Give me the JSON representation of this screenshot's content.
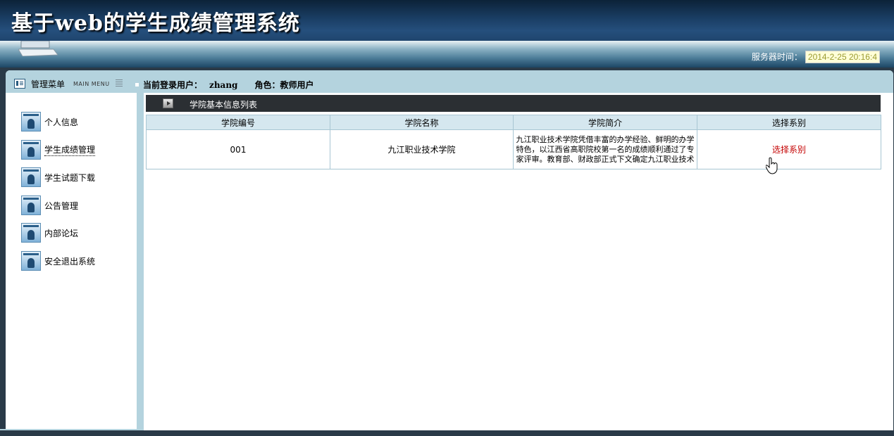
{
  "header": {
    "title": "基于web的学生成绩管理系统",
    "server_time_label": "服务器时间：",
    "server_time_value": "2014-2-25 20:16:4"
  },
  "menu": {
    "title": "管理菜单",
    "title_en": "MAIN MENU",
    "items": [
      {
        "label": "个人信息",
        "icon": "user-icon"
      },
      {
        "label": "学生成绩管理",
        "icon": "user-icon",
        "active": true
      },
      {
        "label": "学生试题下载",
        "icon": "user-icon"
      },
      {
        "label": "公告管理",
        "icon": "user-icon"
      },
      {
        "label": "内部论坛",
        "icon": "user-icon"
      },
      {
        "label": "安全退出系统",
        "icon": "user-icon"
      }
    ]
  },
  "user": {
    "login_label": "当前登录用户：",
    "username": "zhang",
    "role_label": "角色：",
    "role": "教师用户"
  },
  "content": {
    "title": "学院基本信息列表",
    "columns": [
      "学院编号",
      "学院名称",
      "学院简介",
      "选择系别"
    ],
    "rows": [
      {
        "id": "001",
        "name": "九江职业技术学院",
        "intro": "九江职业技术学院凭借丰富的办学经验、鲜明的办学特色，以江西省高职院校第一名的成绩顺利通过了专家评审。教育部、财政部正式下文确定九江职业技术",
        "action": "选择系别"
      }
    ]
  },
  "colors": {
    "header_dark": "#0c2238",
    "frame_accent": "#b4d3de",
    "title_bar": "#2b2f33",
    "table_header": "#d5e7ef",
    "link": "#c40000"
  }
}
